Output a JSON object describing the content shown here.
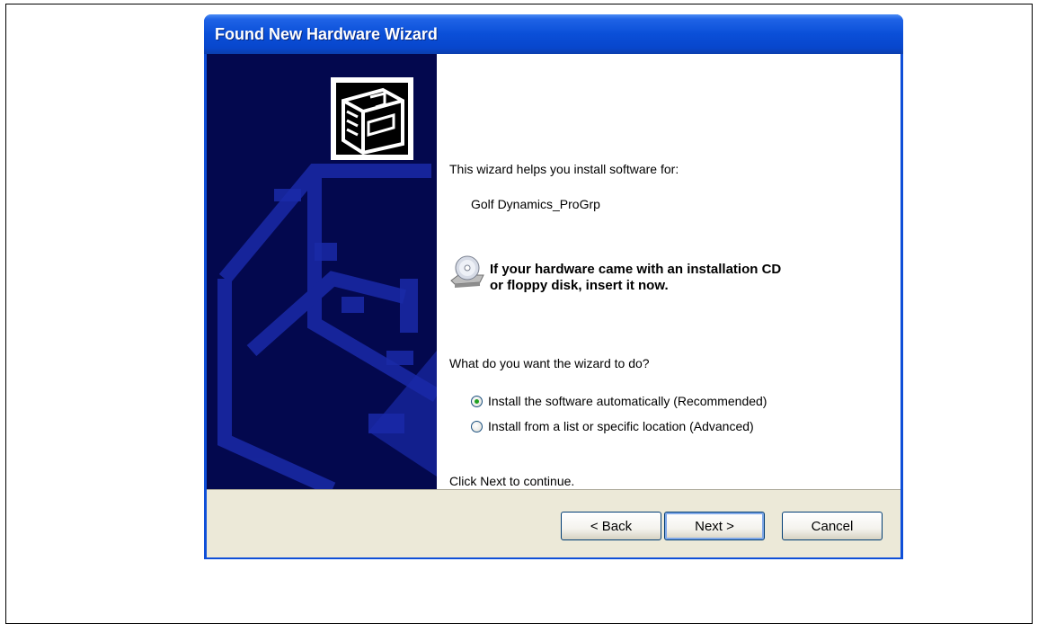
{
  "window": {
    "title": "Found New Hardware Wizard"
  },
  "content": {
    "intro": "This wizard helps you install software for:",
    "device_name": "Golf Dynamics_ProGrp",
    "cd_prompt_line1": "If your hardware came with an installation CD",
    "cd_prompt_line2": "or floppy disk, insert it now.",
    "question": "What do you want the wizard to do?",
    "options": [
      {
        "label": "Install the software automatically (Recommended)",
        "selected": true
      },
      {
        "label": "Install from a list or specific location (Advanced)",
        "selected": false
      }
    ],
    "continue_hint": "Click Next to continue."
  },
  "buttons": {
    "back": "< Back",
    "next": "Next >",
    "cancel": "Cancel"
  },
  "icons": {
    "wizard": "hardware-wizard-icon",
    "cd": "cd-drive-icon"
  },
  "colors": {
    "title_bar": "#0a4fd8",
    "left_panel": "#03084e",
    "button_bar": "#ece9d8"
  }
}
